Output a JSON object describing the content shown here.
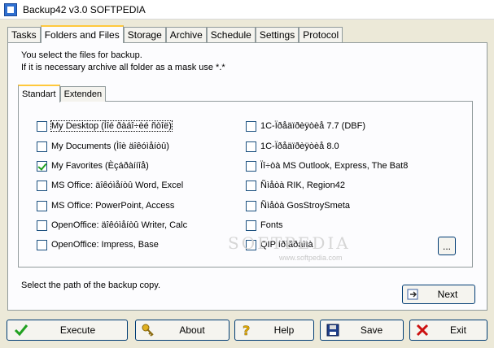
{
  "window": {
    "title": "Backup42 v3.0    SOFTPEDIA"
  },
  "tabs": [
    {
      "label": "Tasks"
    },
    {
      "label": "Folders and Files"
    },
    {
      "label": "Storage"
    },
    {
      "label": "Archive"
    },
    {
      "label": "Schedule"
    },
    {
      "label": "Settings"
    },
    {
      "label": "Protocol"
    }
  ],
  "info": {
    "line1": "You select the files for backup.",
    "line2": "If it is necessary archive all folder as a mask use *.*"
  },
  "subtabs": [
    {
      "label": "Standart"
    },
    {
      "label": "Extenden"
    }
  ],
  "left_items": [
    {
      "label": "My Desktop (Ìîé ðàáî÷èé ñòîë)",
      "checked": false
    },
    {
      "label": "My Documents (Ìîè äîêóìåíòû)",
      "checked": false
    },
    {
      "label": "My Favorites (Èçáðàííîå)",
      "checked": true
    },
    {
      "label": "MS Office: äîêóìåíòû Word, Excel",
      "checked": false
    },
    {
      "label": "MS Office: PowerPoint, Access",
      "checked": false
    },
    {
      "label": "OpenOffice: äîêóìåíòû Writer, Calc",
      "checked": false
    },
    {
      "label": "OpenOffice: Impress, Base",
      "checked": false
    }
  ],
  "right_items": [
    {
      "label": "1C-Ïðåäïðèÿòèå 7.7 (DBF)",
      "checked": false
    },
    {
      "label": "1C-Ïðåäïðèÿòèå 8.0",
      "checked": false
    },
    {
      "label": "Ïî÷òà MS Outlook, Express, The Bat8",
      "checked": false
    },
    {
      "label": "Ñìåòà RIK, Region42",
      "checked": false
    },
    {
      "label": "Ñìåòà GosStroySmeta",
      "checked": false
    },
    {
      "label": "Fonts",
      "checked": false
    },
    {
      "label": "QIP íðîãðàììà",
      "checked": false
    }
  ],
  "browse_label": "...",
  "watermark": "SOFTPEDIA",
  "watermark_url": "www.softpedia.com",
  "path_prompt": "Select the path of the backup copy.",
  "next_label": "Next",
  "footer": {
    "execute": "Execute",
    "about": "About",
    "help": "Help",
    "save": "Save",
    "exit": "Exit"
  },
  "colors": {
    "face": "#ece9d8",
    "tab_highlight": "#ffc83c",
    "check_green": "#21a121",
    "exit_red": "#cc1111"
  }
}
